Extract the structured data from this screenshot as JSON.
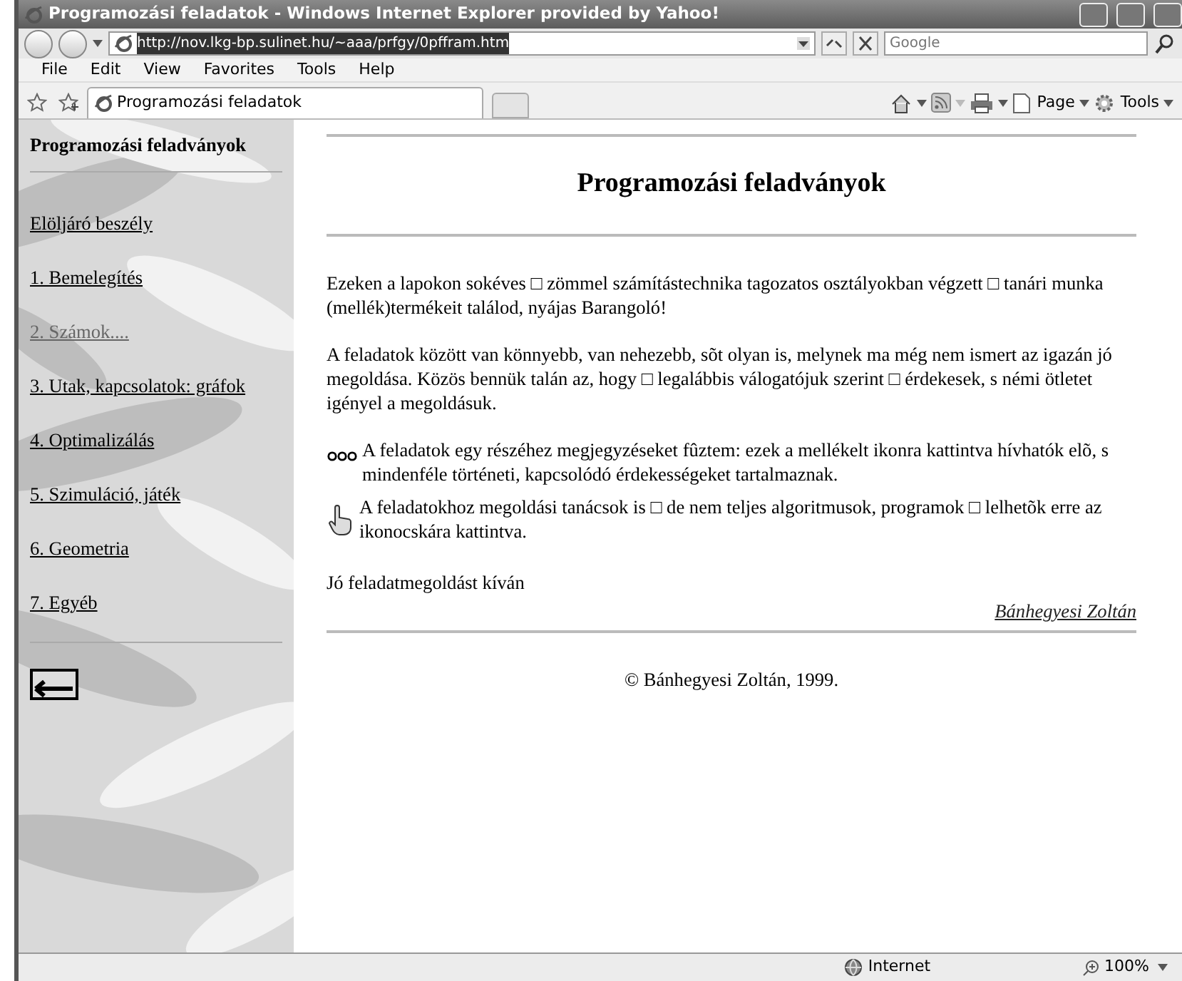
{
  "window": {
    "title": "Programozási feladatok - Windows Internet Explorer provided by Yahoo!"
  },
  "address_bar": {
    "url": "http://nov.lkg-bp.sulinet.hu/~aaa/prfgy/0pffram.htm",
    "search_placeholder": "Google"
  },
  "menu": [
    "File",
    "Edit",
    "View",
    "Favorites",
    "Tools",
    "Help"
  ],
  "tabs": [
    {
      "label": "Programozási feladatok",
      "selected": true
    }
  ],
  "command_bar": [
    "Page",
    "Tools"
  ],
  "sidebar": {
    "title": "Programozási feladványok",
    "links": [
      {
        "text": "Elöljáró beszély",
        "visited": false
      },
      {
        "text": "1. Bemelegítés",
        "visited": false
      },
      {
        "text": "2. Számok....",
        "visited": true
      },
      {
        "text": "3. Utak, kapcsolatok: gráfok",
        "visited": false
      },
      {
        "text": "4. Optimalizálás",
        "visited": false
      },
      {
        "text": "5. Szimuláció, játék",
        "visited": false
      },
      {
        "text": "6. Geometria",
        "visited": false
      },
      {
        "text": "7. Egyéb",
        "visited": false
      }
    ]
  },
  "main": {
    "heading": "Programozási feladványok",
    "paragraphs": [
      "Ezeken a lapokon sokéves □ zömmel számítástechnika tagozatos osztályokban végzett □ tanári munka (mellék)termékeit találod, nyájas Barangoló!",
      "A feladatok között van könnyebb, van nehezebb, sõt olyan is, melynek ma még nem ismert az igazán jó megoldása. Közös bennük talán az, hogy □ legalábbis válogatójuk szerint □ érdekesek, s némi ötletet igényel a megoldásuk."
    ],
    "notes": [
      {
        "kind": "comments",
        "text": "A feladatok egy részéhez megjegyzéseket fûztem: ezek a mellékelt ikonra kattintva hívhatók elõ, s mindenféle történeti, kapcsolódó érdekességeket tartalmaznak."
      },
      {
        "kind": "hints",
        "text": "A feladatokhoz megoldási tanácsok is □ de nem teljes algoritmusok, programok □ lelhetõk erre az ikonocskára kattintva."
      }
    ],
    "closing": "Jó feladatmegoldást kíván",
    "signature": "Bánhegyesi Zoltán",
    "copyright": "© Bánhegyesi Zoltán, 1999."
  },
  "status_bar": {
    "zone": "Internet",
    "zoom": "100%"
  }
}
